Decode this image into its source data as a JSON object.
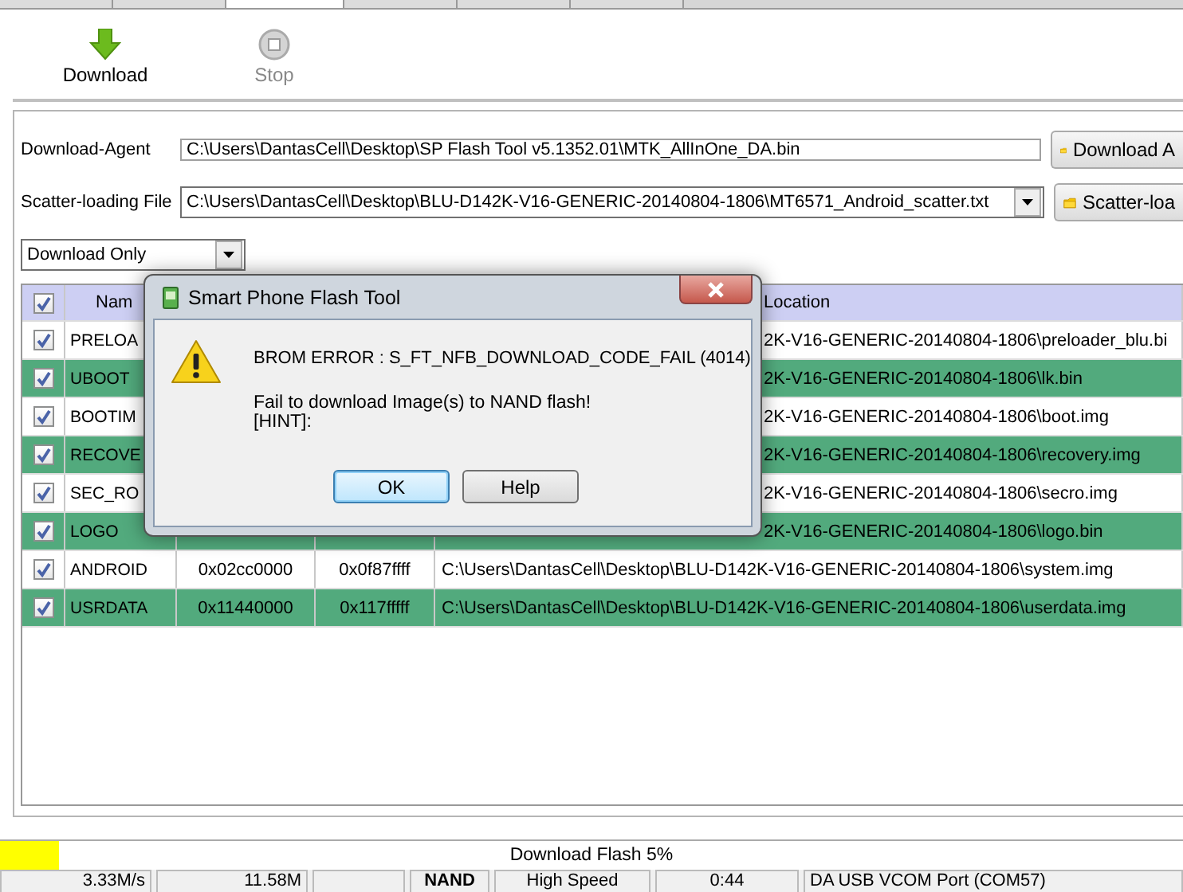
{
  "tabs": [
    {
      "selected": false
    },
    {
      "selected": false
    },
    {
      "selected": true
    },
    {
      "selected": false
    },
    {
      "selected": false
    },
    {
      "selected": false
    }
  ],
  "toolbar": [
    {
      "kind": "download",
      "label": "Download",
      "disabled": false
    },
    {
      "kind": "stop",
      "label": "Stop",
      "disabled": true
    }
  ],
  "download_agent": {
    "label": "Download-Agent",
    "value": "C:\\Users\\DantasCell\\Desktop\\SP Flash Tool v5.1352.01\\MTK_AllInOne_DA.bin",
    "button": "Download A"
  },
  "scatter_file": {
    "label": "Scatter-loading File",
    "value": "C:\\Users\\DantasCell\\Desktop\\BLU-D142K-V16-GENERIC-20140804-1806\\MT6571_Android_scatter.txt",
    "button": "Scatter-loa"
  },
  "mode_select": {
    "value": "Download Only"
  },
  "table": {
    "header_checked": true,
    "name_column": "Nam",
    "location_column": "Location",
    "rows": [
      {
        "checked": true,
        "name": "PRELOA",
        "location": "2K-V16-GENERIC-20140804-1806\\preloader_blu.bi"
      },
      {
        "checked": true,
        "name": "UBOOT",
        "location": "2K-V16-GENERIC-20140804-1806\\lk.bin"
      },
      {
        "checked": true,
        "name": "BOOTIM",
        "location": "2K-V16-GENERIC-20140804-1806\\boot.img"
      },
      {
        "checked": true,
        "name": "RECOVE",
        "location": "2K-V16-GENERIC-20140804-1806\\recovery.img"
      },
      {
        "checked": true,
        "name": "SEC_RO",
        "location": "2K-V16-GENERIC-20140804-1806\\secro.img"
      },
      {
        "checked": true,
        "name": "LOGO",
        "location": "2K-V16-GENERIC-20140804-1806\\logo.bin"
      },
      {
        "checked": true,
        "name": "ANDROID",
        "begin": "0x02cc0000",
        "end": "0x0f87ffff",
        "location": "C:\\Users\\DantasCell\\Desktop\\BLU-D142K-V16-GENERIC-20140804-1806\\system.img"
      },
      {
        "checked": true,
        "name": "USRDATA",
        "begin": "0x11440000",
        "end": "0x117fffff",
        "location": "C:\\Users\\DantasCell\\Desktop\\BLU-D142K-V16-GENERIC-20140804-1806\\userdata.img"
      }
    ]
  },
  "dialog": {
    "title": "Smart Phone Flash Tool",
    "error": "BROM ERROR : S_FT_NFB_DOWNLOAD_CODE_FAIL (4014)",
    "message": "Fail to download Image(s) to NAND flash!",
    "hint": "[HINT]:",
    "buttons": [
      {
        "label": "OK",
        "focused": true
      },
      {
        "label": "Help",
        "focused": false
      }
    ]
  },
  "progress": {
    "label": "Download Flash 5%",
    "level": 0.05
  },
  "status_bar": {
    "speed": "3.33M/s",
    "size": "11.58M",
    "storage": "NAND",
    "usb_speed": "High Speed",
    "time": "0:44",
    "port": "DA USB VCOM Port (COM57)"
  }
}
